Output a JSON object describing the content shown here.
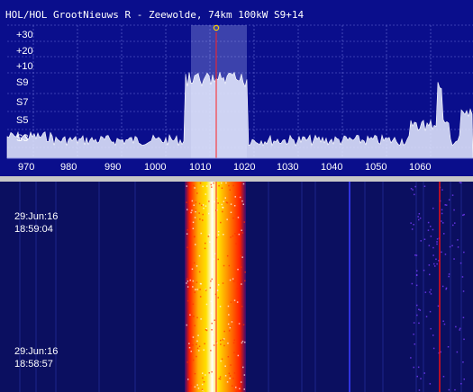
{
  "spectrum": {
    "station_title": "HOL/HOL GrootNieuws R - Zeewolde, 74km 100kW S9+14",
    "level_labels": [
      "+30",
      "+20",
      "+10",
      "S9",
      "S7",
      "S5",
      "S3"
    ],
    "freq_labels": [
      "970",
      "980",
      "990",
      "1000",
      "1010",
      "1020",
      "1030",
      "1040",
      "1050",
      "1060"
    ],
    "tuned_freq_khz": 1008,
    "passband_khz": [
      1003,
      1013
    ],
    "colors": {
      "background": "#0a0e8c",
      "grid": "#6a70d8",
      "trace": "#ffffff",
      "passband": "#9aa2e8",
      "tuning_line": "#ff2020",
      "marker": "#ffd000"
    }
  },
  "waterfall": {
    "timestamps": [
      {
        "date": "29:Jun:16",
        "time": "18:59:04"
      },
      {
        "date": "29:Jun:16",
        "time": "18:58:57"
      }
    ],
    "colors": {
      "background": "#0b0f60",
      "signal_hot": "#ffe000",
      "signal_warm": "#ff2000",
      "carrier_line": "#ff1010"
    }
  }
}
